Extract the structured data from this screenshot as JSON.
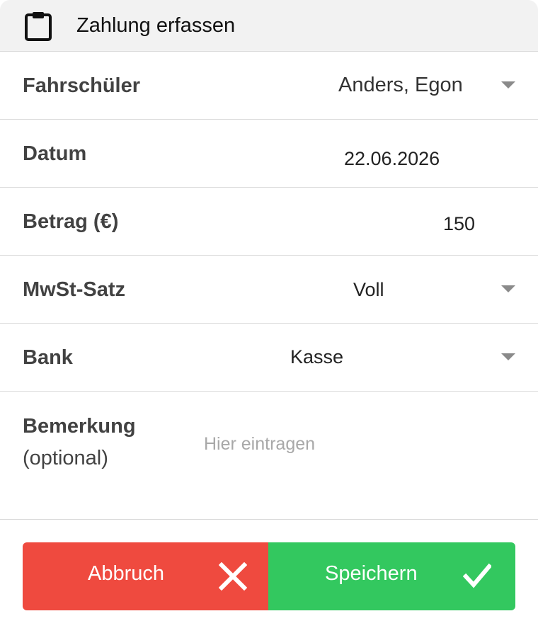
{
  "dialog": {
    "title": "Zahlung erfassen",
    "title_icon": "clipboard-icon"
  },
  "form": {
    "student": {
      "label": "Fahrschüler",
      "value": "Anders, Egon"
    },
    "date": {
      "label": "Datum",
      "value": "22.06.2026"
    },
    "amount": {
      "label": "Betrag (€)",
      "value": "150"
    },
    "vat": {
      "label": "MwSt-Satz",
      "value": "Voll"
    },
    "bank": {
      "label": "Bank",
      "value": "Kasse"
    },
    "note": {
      "label": "Bemerkung",
      "label_sub": "(optional)",
      "placeholder": "Hier eintragen",
      "value": ""
    }
  },
  "buttons": {
    "cancel": {
      "label": "Abbruch",
      "icon": "close-icon",
      "color": "#ef4a3f"
    },
    "save": {
      "label": "Speichern",
      "icon": "checkmark-icon",
      "color": "#33c85f"
    }
  }
}
